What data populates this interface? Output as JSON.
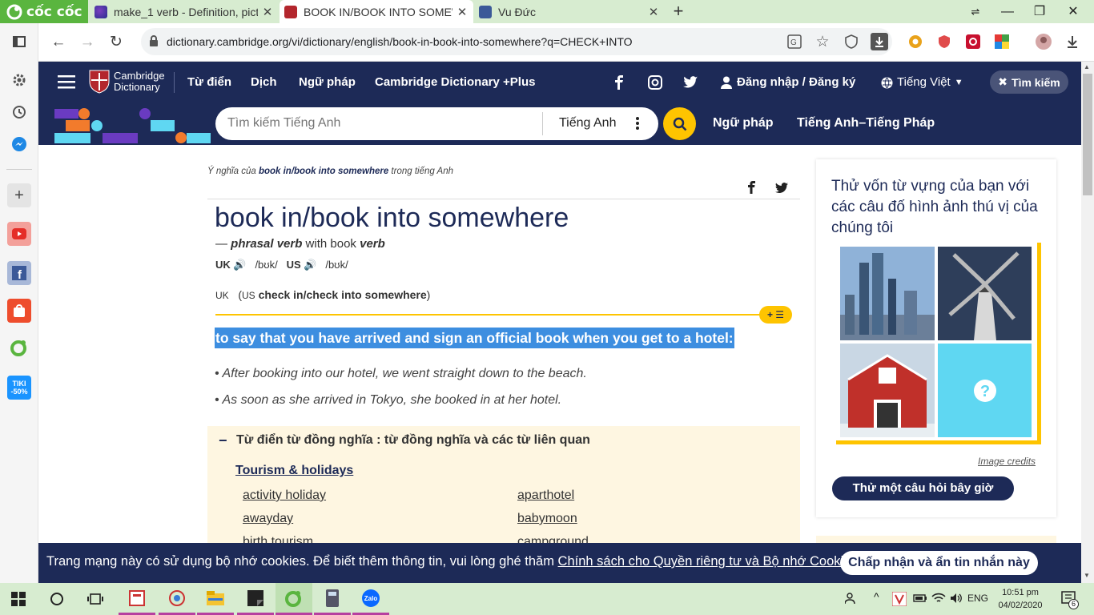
{
  "browser": {
    "brand": "cốc cốc",
    "tabs": [
      {
        "label": "make_1 verb - Definition, pict",
        "icon": "globe-icon",
        "active": false
      },
      {
        "label": "BOOK IN/BOOK INTO SOMEW",
        "icon": "cambridge-icon",
        "active": true
      },
      {
        "label": "Vu Đức",
        "icon": "facebook-icon",
        "active": false
      }
    ],
    "url": "dictionary.cambridge.org/vi/dictionary/english/book-in-book-into-somewhere?q=CHECK+INTO"
  },
  "site": {
    "logo_line1": "Cambridge",
    "logo_line2": "Dictionary",
    "nav": [
      "Từ điển",
      "Dịch",
      "Ngữ pháp",
      "Cambridge Dictionary +Plus"
    ],
    "login": "Đăng nhập / Đăng ký",
    "language": "Tiếng Việt",
    "search_button": "Tìm kiếm",
    "search_placeholder": "Tìm kiếm Tiếng Anh",
    "search_lang": "Tiếng Anh",
    "link_grammar": "Ngữ pháp",
    "link_en_fr": "Tiếng Anh–Tiếng Pháp",
    "brand_colors": {
      "navy": "#1d2a57",
      "yellow": "#fec400",
      "highlight": "#3d8ee0"
    }
  },
  "entry": {
    "crumb_pre": "Ý nghĩa của ",
    "crumb_word": "book in/book into somewhere",
    "crumb_post": " trong tiếng Anh",
    "headword": "book in/book into somewhere",
    "pos_dash": "— ",
    "pos": "phrasal verb",
    "pos_with": " with book ",
    "pos_verb": "verb",
    "uk_label": "UK",
    "uk_ipa": "/bʊk/",
    "us_label": "US",
    "us_ipa": "/bʊk/",
    "region_uk": "UK",
    "region_paren_open": "(",
    "region_us": "US",
    "region_word": "check in/check into somewhere",
    "region_paren_close": ")",
    "badge": "+ ☰",
    "definition": "to say that you have arrived and sign an official book when you get to a hotel:",
    "examples": [
      "• After booking into our hotel, we went straight down to the beach.",
      "• As soon as she arrived in Tokyo, she booked in at her hotel."
    ]
  },
  "thesaurus": {
    "title": "Từ điển từ đồng nghĩa : từ đồng nghĩa và các từ liên quan",
    "topic": "Tourism & holidays",
    "words_left": [
      "activity holiday",
      "awayday",
      "birth tourism"
    ],
    "words_right": [
      "aparthotel",
      "babymoon",
      "campground"
    ]
  },
  "quiz": {
    "title": "Thử vốn từ vựng của bạn với các câu đố hình ảnh thú vị của chúng tôi",
    "credits": "Image credits",
    "button": "Thử một câu hỏi bây giờ"
  },
  "cookie": {
    "text": "Trang mạng này có sử dụng bộ nhớ cookies. Để biết thêm thông tin, vui lòng ghé thăm ",
    "link": "Chính sách cho Quyền riêng tư và Bộ nhớ Cookies",
    "end": ".",
    "button": "Chấp nhận và ẩn tin nhắn này"
  },
  "taskbar": {
    "lang": "ENG",
    "time": "10:51 pm",
    "date": "04/02/2020",
    "notifications": "6"
  }
}
